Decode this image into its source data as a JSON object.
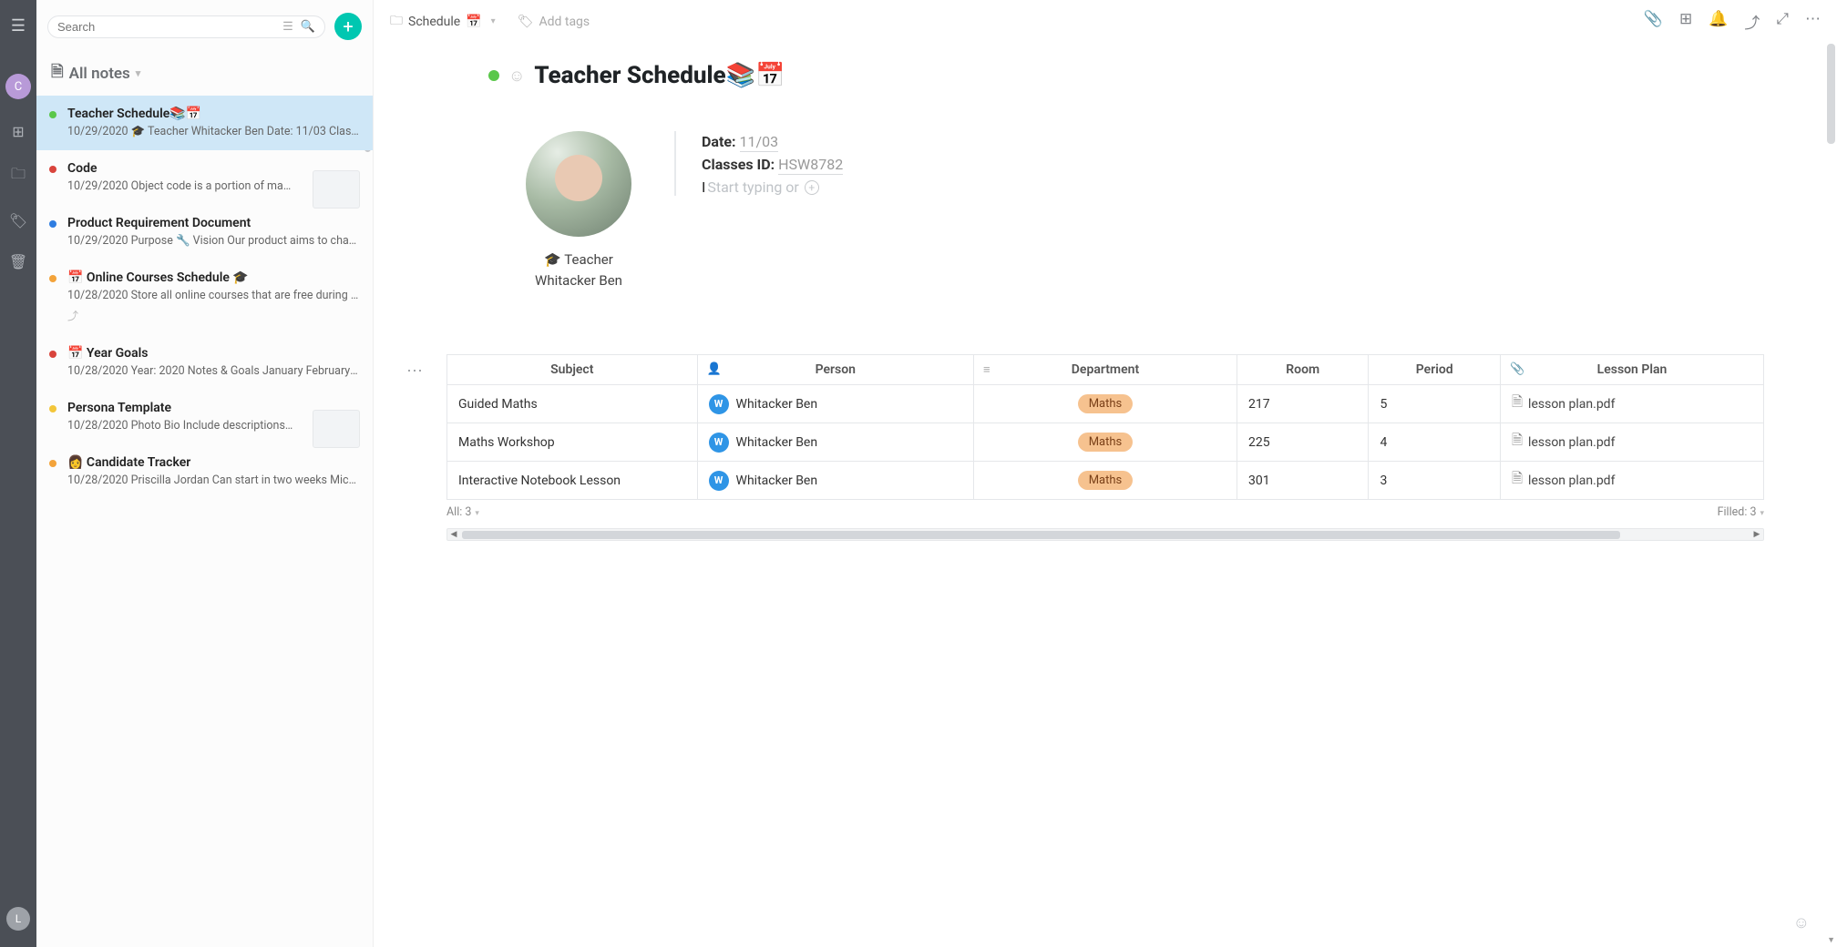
{
  "rail": {
    "user_initial": "C",
    "bottom_initial": "L"
  },
  "sidebar": {
    "search_placeholder": "Search",
    "heading": "All notes",
    "items": [
      {
        "dot": "#5ac74a",
        "title": "Teacher Schedule",
        "emoji": "📚📅",
        "snippet": "10/29/2020 🎓 Teacher Whitacker Ben Date: 11/03 Classe…",
        "selected": true
      },
      {
        "dot": "#d9443c",
        "title": "Code",
        "snippet": "10/29/2020 Object code is a portion of ma…",
        "thumb": true
      },
      {
        "dot": "#2f7de1",
        "title": "Product Requirement Document",
        "snippet": "10/29/2020 Purpose 🔧 Vision Our product aims to chan…"
      },
      {
        "dot": "#f3a33a",
        "title": "📅 Online Courses Schedule 🎓",
        "snippet": "10/28/2020 Store all online courses that are free during c…",
        "share": true
      },
      {
        "dot": "#d9443c",
        "title": "📅 Year Goals",
        "snippet": "10/28/2020 Year: 2020 Notes & Goals January February …"
      },
      {
        "dot": "#f3c63a",
        "title": "Persona Template",
        "snippet": "10/28/2020 Photo Bio Include descriptions…",
        "thumb": true
      },
      {
        "dot": "#f3a33a",
        "title": "👩 Candidate Tracker",
        "snippet": "10/28/2020 Priscilla Jordan Can start in two weeks Micha…"
      }
    ]
  },
  "breadcrumb": {
    "icon": "🗀",
    "label": "Schedule",
    "emoji": "📅"
  },
  "tags_placeholder": "Add tags",
  "doc": {
    "title": "Teacher Schedule",
    "title_emoji": "📚📅",
    "teacher": {
      "role": "🎓 Teacher",
      "name": "Whitacker Ben"
    },
    "date_label": "Date",
    "date_value": "11/03",
    "classes_label": "Classes ID",
    "classes_value": "HSW8782",
    "placeholder": "Start typing or"
  },
  "table": {
    "headers": [
      "Subject",
      "Person",
      "Department",
      "Room",
      "Period",
      "Lesson Plan"
    ],
    "rows": [
      {
        "subject": "Guided Maths",
        "person": "Whitacker Ben",
        "initial": "W",
        "dept": "Maths",
        "room": "217",
        "period": "5",
        "file": "lesson plan.pdf"
      },
      {
        "subject": "Maths Workshop",
        "person": "Whitacker Ben",
        "initial": "W",
        "dept": "Maths",
        "room": "225",
        "period": "4",
        "file": "lesson plan.pdf"
      },
      {
        "subject": "Interactive Notebook Lesson",
        "person": "Whitacker Ben",
        "initial": "W",
        "dept": "Maths",
        "room": "301",
        "period": "3",
        "file": "lesson plan.pdf"
      }
    ],
    "footer_all": "All: 3",
    "footer_filled": "Filled: 3"
  }
}
